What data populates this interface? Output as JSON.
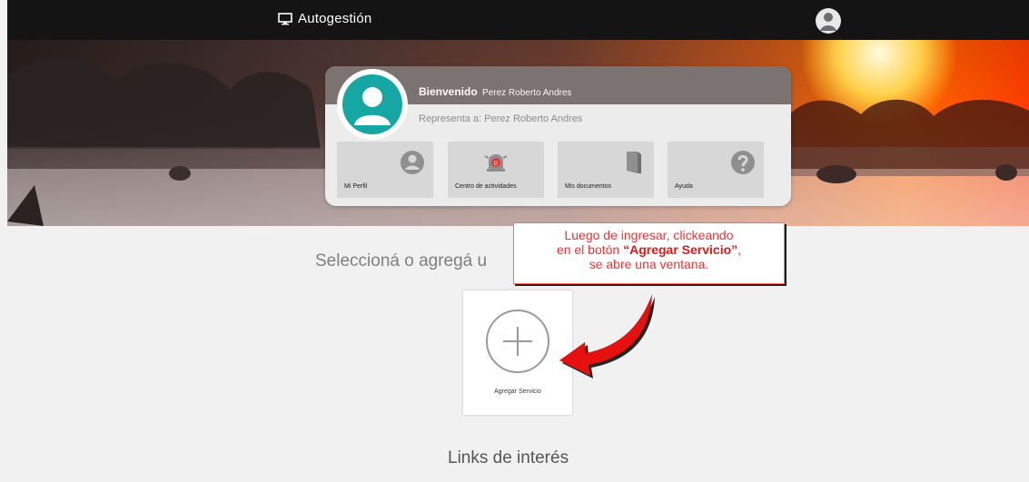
{
  "topbar": {
    "app_name": "Autogestión"
  },
  "profile": {
    "welcome_label": "Bienvenido",
    "user_name": "Perez Roberto Andres",
    "represents_label": "Representa a:",
    "represents_name": "Perez Roberto Andres"
  },
  "tiles": [
    {
      "label": "Mi Perfil",
      "icon": "user-circle-icon"
    },
    {
      "label": "Centro de actividades",
      "icon": "alarm-bell-icon",
      "badge": "0"
    },
    {
      "label": "Mis documentos",
      "icon": "document-icon"
    },
    {
      "label": "Ayuda",
      "icon": "question-icon"
    }
  ],
  "main": {
    "section_title": "Seleccioná o agregá u",
    "add_service_label": "Agregar Servicio",
    "links_title": "Links de interés"
  },
  "callout": {
    "line1": "Luego de ingresar, clickeando",
    "line2_prefix": "en el botón ",
    "line2_bold": "“Agregar Servicio”",
    "line2_suffix": ",",
    "line3": "se abre una ventana."
  },
  "colors": {
    "accent_red": "#e01818",
    "teal": "#16a7a5"
  }
}
